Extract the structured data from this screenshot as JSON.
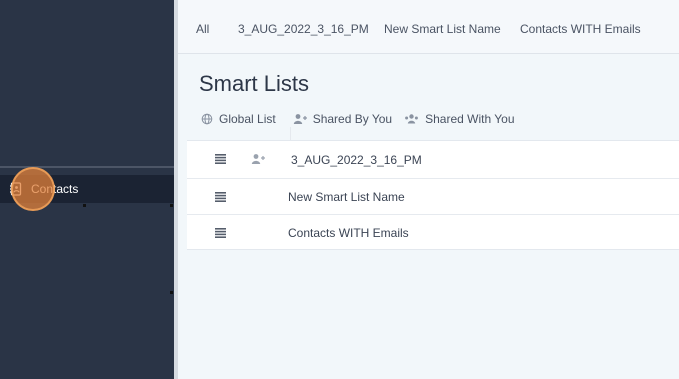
{
  "sidebar": {
    "active_item": {
      "label": "Contacts",
      "icon": "contacts-book-icon"
    }
  },
  "tabs": [
    {
      "label": "All"
    },
    {
      "label": "3_AUG_2022_3_16_PM"
    },
    {
      "label": "New Smart List Name"
    },
    {
      "label": "Contacts WITH Emails"
    }
  ],
  "page": {
    "title": "Smart Lists",
    "filters": [
      {
        "label": "Global List",
        "icon": "globe-icon"
      },
      {
        "label": "Shared By You",
        "icon": "user-plus-icon"
      },
      {
        "label": "Shared With You",
        "icon": "users-icon"
      }
    ]
  },
  "lists": [
    {
      "name": "3_AUG_2022_3_16_PM",
      "shared": true
    },
    {
      "name": "New Smart List Name",
      "shared": false
    },
    {
      "name": "Contacts WITH Emails",
      "shared": false
    }
  ],
  "colors": {
    "sidebar_bg": "#2a3446",
    "sidebar_active_bg": "#1b2333",
    "click_marker": "#e2803a",
    "page_bg": "#f2f7fa"
  }
}
